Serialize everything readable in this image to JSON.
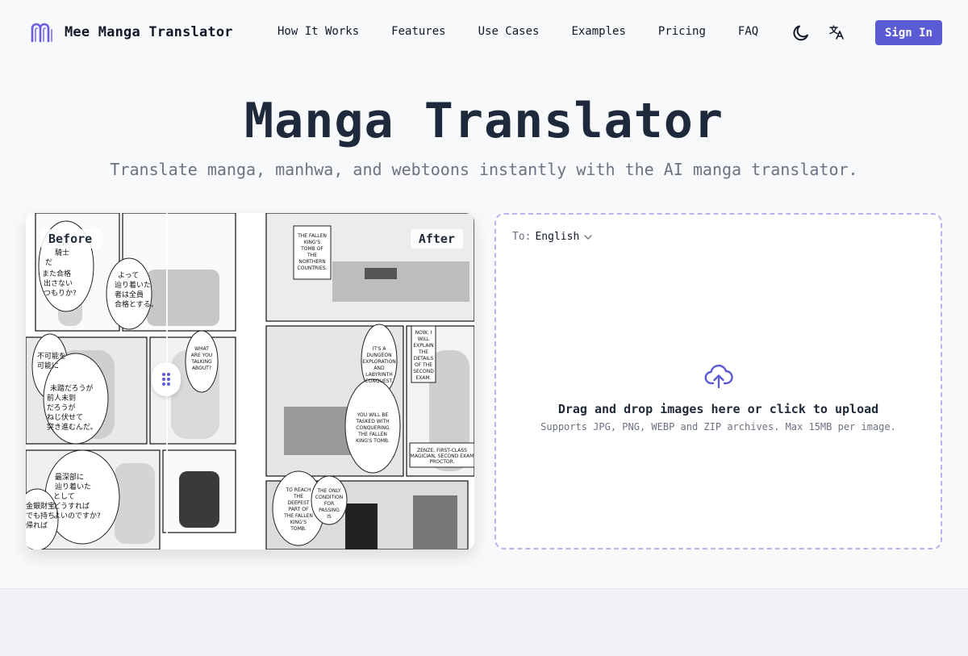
{
  "brand": {
    "name": "Mee Manga Translator",
    "logo_icon": "m-logo-icon",
    "accent": "#5b5bd6"
  },
  "nav": {
    "links": [
      "How It Works",
      "Features",
      "Use Cases",
      "Examples",
      "Pricing",
      "FAQ"
    ],
    "theme_icon": "moon-icon",
    "language_icon": "translate-icon",
    "signin_label": "Sign In"
  },
  "hero": {
    "title": "Manga Translator",
    "subtitle": "Translate manga, manhwa, and webtoons instantly with the AI manga translator."
  },
  "comparison": {
    "before_label": "Before",
    "after_label": "After",
    "handle_icon": "drag-handle-icon",
    "before_texts": [
      "これは騎士のだ",
      "また合格者を出さないつもりか?",
      "よって辿り着いた者は全員合格とする。",
      "不可能を可能にする一級魔法使い",
      "未踏だろうが前人未到だろうがねじ伏せて突き進むんだ。",
      "最深部に辿り着いたとしてどうすればよいのですか?",
      "金銀財宝でも持ち帰ればいいのかしら"
    ],
    "after_texts": [
      "THE FALLEN KING'S TOMB OF THE NORTHERN COUNTRIES.",
      "WHAT ARE YOU TALKING ABOUT?",
      "IT'S A DUNGEON EXPLORATION AND LABYRINTH CONQUEST.",
      "NOW, I WILL EXPLAIN THE DETAILS OF THE SECOND EXAM.",
      "YOU WILL BE TASKED WITH CONQUERING THE FALLEN KING'S TOMB.",
      "ZENZE, FIRST-CLASS MAGICIAN, SECOND EXAM PROCTOR.",
      "TO REACH THE DEEPEST PART OF THE FALLEN KING'S TOMB.",
      "THE ONLY CONDITION FOR PASSING IS"
    ]
  },
  "upload": {
    "to_label": "To:",
    "language": "English",
    "chevron_icon": "chevron-down-icon",
    "upload_icon": "cloud-upload-icon",
    "main_text": "Drag and drop images here or click to upload",
    "hint_text": "Supports JPG, PNG, WEBP and ZIP archives. Max 15MB per image."
  }
}
